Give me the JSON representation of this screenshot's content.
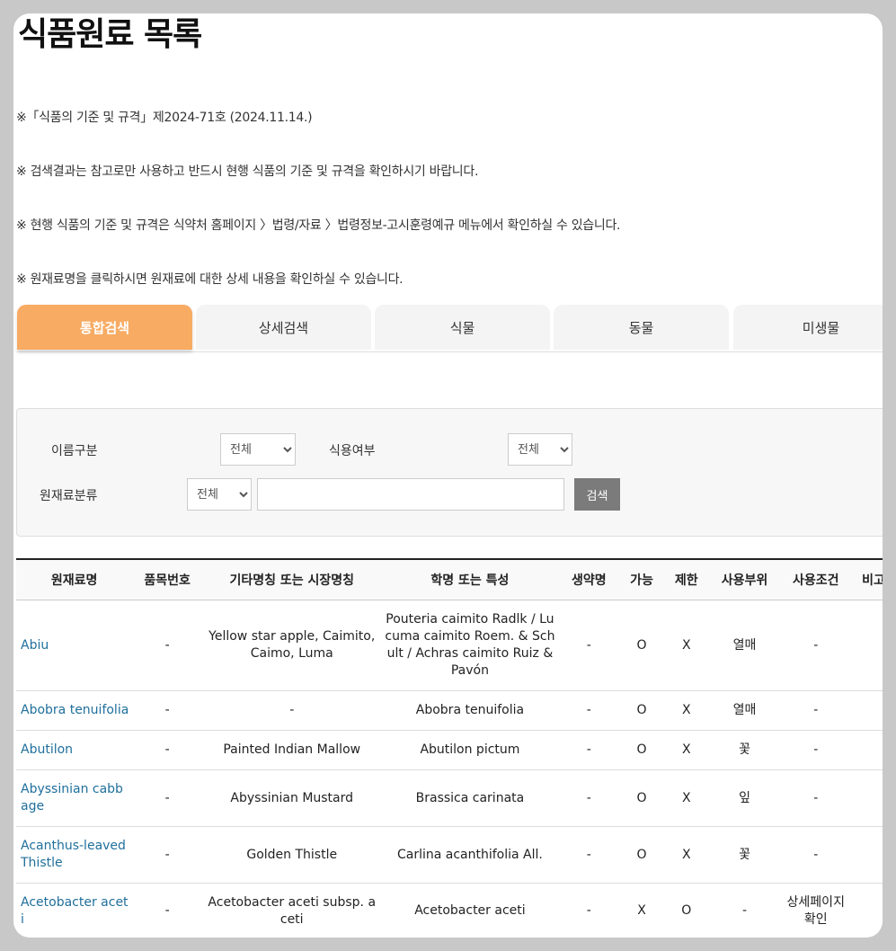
{
  "page": {
    "title": "식품원료 목록",
    "notes": [
      "※「식품의 기준 및 규격」제2024-71호 (2024.11.14.)",
      "※ 검색결과는 참고로만 사용하고 반드시 현행 식품의 기준 및 규격을 확인하시기 바랍니다.",
      "※ 현행 식품의 기준 및 규격은 식약처 홈페이지 〉법령/자료 〉법령정보-고시훈령예규 메뉴에서 확인하실 수 있습니다.",
      "※ 원재료명을 클릭하시면 원재료에 대한 상세 내용을 확인하실 수 있습니다."
    ]
  },
  "tabs": [
    "통합검색",
    "상세검색",
    "식물",
    "동물",
    "미생물"
  ],
  "search": {
    "name_type_label": "이름구분",
    "name_type_value": "전체",
    "edible_label": "식용여부",
    "edible_value": "전체",
    "category_label": "원재료분류",
    "category_value": "전체",
    "keyword_value": "",
    "button_label": "검색"
  },
  "table": {
    "headers": [
      "원재료명",
      "품목번호",
      "기타명칭 또는 시장명칭",
      "학명 또는 특성",
      "생약명",
      "가능",
      "제한",
      "사용부위",
      "사용조건",
      "비고"
    ],
    "rows": [
      [
        "Abiu",
        "-",
        "Yellow star apple, Caimito, Caimo, Luma",
        "Pouteria caimito Radlk / Lucuma caimito Roem. & Schult / Achras caimito Ruiz & Pavón",
        "-",
        "O",
        "X",
        "열매",
        "-",
        ""
      ],
      [
        "Abobra tenuifolia",
        "-",
        "-",
        "Abobra tenuifolia",
        "-",
        "O",
        "X",
        "열매",
        "-",
        ""
      ],
      [
        "Abutilon",
        "-",
        "Painted Indian Mallow",
        "Abutilon pictum",
        "-",
        "O",
        "X",
        "꽃",
        "-",
        ""
      ],
      [
        "Abyssinian cabbage",
        "-",
        "Abyssinian Mustard",
        "Brassica carinata",
        "-",
        "O",
        "X",
        "잎",
        "-",
        ""
      ],
      [
        "Acanthus-leaved Thistle",
        "-",
        "Golden Thistle",
        "Carlina acanthifolia All.",
        "-",
        "O",
        "X",
        "꽃",
        "-",
        ""
      ],
      [
        "Acetobacter aceti",
        "-",
        "Acetobacter aceti subsp. aceti",
        "Acetobacter aceti",
        "-",
        "X",
        "O",
        "-",
        "상세페이지 확인",
        ""
      ]
    ]
  }
}
